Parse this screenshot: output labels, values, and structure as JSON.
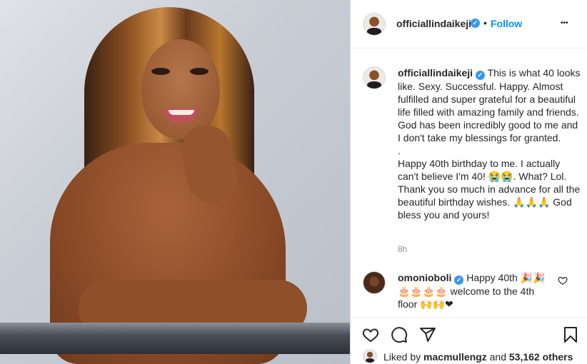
{
  "post": {
    "username": "officiallindaikeji",
    "verified_mark": "✓",
    "separator": "•",
    "follow_label": "Follow",
    "more_label": "•••",
    "image_alt": "Photo of a smiling woman with long highlighted wavy hair leaning on a metal bar"
  },
  "caption": {
    "username": "officiallindaikeji",
    "text": "This is what 40 looks like. Sexy. Successful. Happy. Almost fulfilled and super grateful for a beautiful life filled with amazing family and friends. God has been incredibly good to me and I don't take my blessings for granted.\n.\nHappy 40th birthday to me. I actually can't believe I'm 40! 😭😭. What? Lol. Thank you so much in advance for all the beautiful birthday wishes. 🙏🙏🙏 God bless you and yours!",
    "time": "8h"
  },
  "comment": {
    "username": "omonioboli",
    "text": "Happy 40th 🎉🎉 🎂🎂🎂🎂 welcome to the 4th floor 🙌🙌❤"
  },
  "likes": {
    "prefix": "Liked by ",
    "user": "macmullengz",
    "middle": " and ",
    "count": "53,162 others"
  },
  "icons": {
    "like": "heart-icon",
    "comment": "comment-icon",
    "share": "paper-plane-icon",
    "save": "bookmark-icon",
    "comment_like": "heart-icon"
  },
  "colors": {
    "link": "#0095f6",
    "verified": "#3897f0",
    "muted": "#8e8e8e"
  }
}
